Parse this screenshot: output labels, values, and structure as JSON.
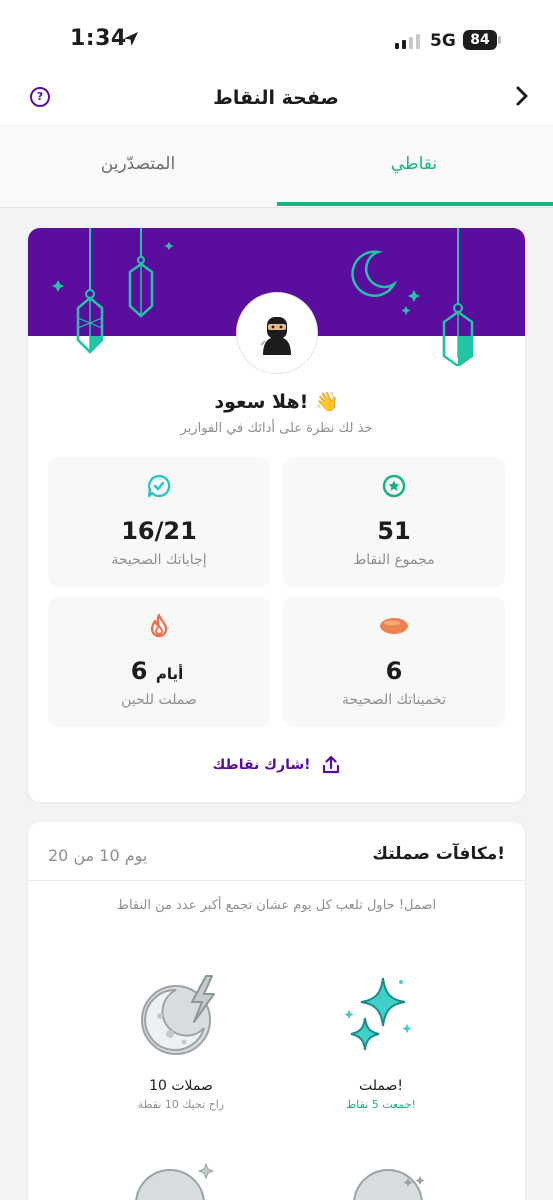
{
  "status_bar": {
    "time": "1:34",
    "network": "5G",
    "battery": "84"
  },
  "header": {
    "title": "صفحة النقاط",
    "help_icon": "help-icon",
    "back_icon": "chevron-right-icon"
  },
  "tabs": [
    {
      "label": "نقاطي",
      "active": true
    },
    {
      "label": "المتصدّرين",
      "active": false
    }
  ],
  "profile": {
    "avatar": "ninja-avatar",
    "greeting": "هلا سعود! 👋",
    "subtitle": "خذ لك نظرة على أدائك في الفوازير"
  },
  "stats": {
    "points": {
      "value": "51",
      "label": "مجموع النقاط",
      "icon": "star-badge-icon"
    },
    "answers": {
      "value": "16/21",
      "label": "إجاباتك الصحيحة",
      "icon": "chat-check-icon"
    },
    "guesses": {
      "value": "6",
      "label": "تخميناتك الصحيحة",
      "icon": "date-icon"
    },
    "streak": {
      "value": "6",
      "unit": "أيام",
      "label": "صملت للحين",
      "icon": "flame-icon"
    }
  },
  "share": {
    "label": "شارك نقاطك!",
    "icon": "share-icon"
  },
  "rewards": {
    "title": "مكافآت صملتك!",
    "day_progress": "يوم 10 من 20",
    "hint": "اصمل! حاول تلعب كل يوم عشان تجمع أكبر عدد من النقاط",
    "items": [
      {
        "name": "صملت!",
        "sub": "جمعت 5 نقاط!",
        "icon": "sparkles-icon",
        "achieved": true
      },
      {
        "name": "10 صملات",
        "sub": "راح تجيك 10 نقطة",
        "icon": "moon-lightning-icon",
        "achieved": false
      }
    ]
  },
  "colors": {
    "purple": "#5b0e9e",
    "green": "#16b57f",
    "teal": "#21c4a5"
  }
}
